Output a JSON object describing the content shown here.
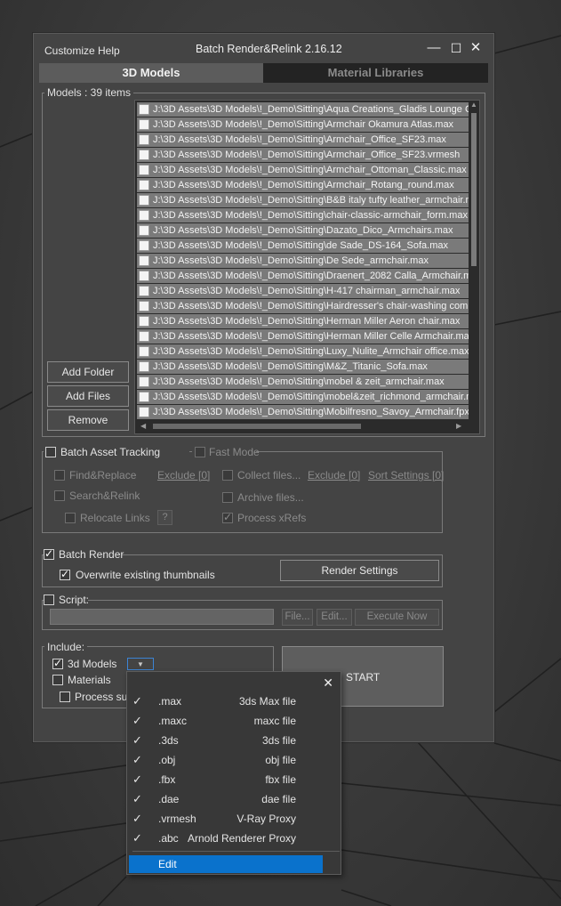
{
  "window": {
    "title": "Batch Render&Relink 2.16.12",
    "menu": [
      "Customize",
      "Help"
    ],
    "controls": {
      "minimize": "—",
      "maximize": "☐",
      "close": "✕"
    }
  },
  "tabs": [
    {
      "label": "3D Models",
      "active": true
    },
    {
      "label": "Material Libraries",
      "active": false
    }
  ],
  "models": {
    "label": "Models : 39 items",
    "files": [
      "J:\\3D Assets\\3D Models\\!_Demo\\Sitting\\Aqua Creations_Gladis Lounge C",
      "J:\\3D Assets\\3D Models\\!_Demo\\Sitting\\Armchair Okamura Atlas.max",
      "J:\\3D Assets\\3D Models\\!_Demo\\Sitting\\Armchair_Office_SF23.max",
      "J:\\3D Assets\\3D Models\\!_Demo\\Sitting\\Armchair_Office_SF23.vrmesh",
      "J:\\3D Assets\\3D Models\\!_Demo\\Sitting\\Armchair_Ottoman_Classic.max",
      "J:\\3D Assets\\3D Models\\!_Demo\\Sitting\\Armchair_Rotang_round.max",
      "J:\\3D Assets\\3D Models\\!_Demo\\Sitting\\B&B italy tufty leather_armchair.m",
      "J:\\3D Assets\\3D Models\\!_Demo\\Sitting\\chair-classic-armchair_form.max",
      "J:\\3D Assets\\3D Models\\!_Demo\\Sitting\\Dazato_Dico_Armchairs.max",
      "J:\\3D Assets\\3D Models\\!_Demo\\Sitting\\de Sade_DS-164_Sofa.max",
      "J:\\3D Assets\\3D Models\\!_Demo\\Sitting\\De Sede_armchair.max",
      "J:\\3D Assets\\3D Models\\!_Demo\\Sitting\\Draenert_2082 Calla_Armchair.m",
      "J:\\3D Assets\\3D Models\\!_Demo\\Sitting\\H-417 chairman_armchair.max",
      "J:\\3D Assets\\3D Models\\!_Demo\\Sitting\\Hairdresser's chair-washing comp",
      "J:\\3D Assets\\3D Models\\!_Demo\\Sitting\\Herman Miller Aeron chair.max",
      "J:\\3D Assets\\3D Models\\!_Demo\\Sitting\\Herman Miller Celle Armchair.max",
      "J:\\3D Assets\\3D Models\\!_Demo\\Sitting\\Luxy_Nulite_Armchair office.max",
      "J:\\3D Assets\\3D Models\\!_Demo\\Sitting\\M&Z_Titanic_Sofa.max",
      "J:\\3D Assets\\3D Models\\!_Demo\\Sitting\\mobel & zeit_armchair.max",
      "J:\\3D Assets\\3D Models\\!_Demo\\Sitting\\mobel&zeit_richmond_armchair.m",
      "J:\\3D Assets\\3D Models\\!_Demo\\Sitting\\Mobilfresno_Savoy_Armchair.fpx"
    ],
    "buttons": {
      "add_folder": "Add Folder",
      "add_files": "Add Files",
      "remove": "Remove"
    }
  },
  "asset_tracking": {
    "label": "Batch Asset Tracking",
    "fast_mode": "Fast Mode",
    "find_replace": "Find&Replace",
    "exclude1": "Exclude [0]",
    "collect_files": "Collect files...",
    "exclude2": "Exclude [0]",
    "sort_settings": "Sort Settings [0]",
    "search_relink": "Search&Relink",
    "archive_files": "Archive files...",
    "relocate_links": "Relocate Links",
    "help": "?",
    "process_xrefs": "Process xRefs"
  },
  "batch_render": {
    "label": "Batch Render",
    "overwrite": "Overwrite existing thumbnails",
    "render_settings": "Render Settings"
  },
  "script": {
    "label": "Script:",
    "file_btn": "File...",
    "edit_btn": "Edit...",
    "execute_btn": "Execute Now"
  },
  "include": {
    "label": "Include:",
    "models": "3d Models",
    "materials": "Materials",
    "process_sub": "Process sub"
  },
  "start": {
    "label": "START"
  },
  "popup": {
    "close": "✕",
    "items": [
      {
        "ext": ".max",
        "desc": "3ds Max file"
      },
      {
        "ext": ".maxc",
        "desc": "maxc file"
      },
      {
        "ext": ".3ds",
        "desc": "3ds file"
      },
      {
        "ext": ".obj",
        "desc": "obj file"
      },
      {
        "ext": ".fbx",
        "desc": "fbx file"
      },
      {
        "ext": ".dae",
        "desc": "dae file"
      },
      {
        "ext": ".vrmesh",
        "desc": "V-Ray Proxy"
      },
      {
        "ext": ".abc",
        "desc": "Arnold Renderer Proxy"
      }
    ],
    "edit": "Edit"
  },
  "colors": {
    "window_bg": "#444444",
    "active_tab": "#5c5c5c",
    "inactive_tab": "#232323",
    "list_row": "#7a7a7a",
    "highlight": "#0a72cc"
  }
}
